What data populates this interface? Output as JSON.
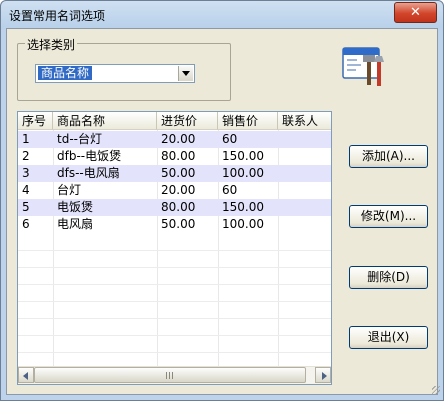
{
  "window": {
    "title": "设置常用名词选项",
    "close_symbol": "✕"
  },
  "category": {
    "legend": "选择类别",
    "selected": "商品名称"
  },
  "table": {
    "columns": [
      "序号",
      "商品名称",
      "进货价",
      "销售价",
      "联系人"
    ],
    "rows": [
      [
        "1",
        "td--台灯",
        "20.00",
        "60",
        ""
      ],
      [
        "2",
        "dfb--电饭煲",
        "80.00",
        "150.00",
        ""
      ],
      [
        "3",
        "dfs--电风扇",
        "50.00",
        "100.00",
        ""
      ],
      [
        "4",
        "台灯",
        "20.00",
        "60",
        ""
      ],
      [
        "5",
        "电饭煲",
        "80.00",
        "150.00",
        ""
      ],
      [
        "6",
        "电风扇",
        "50.00",
        "100.00",
        ""
      ]
    ]
  },
  "buttons": {
    "add": "添加(A)...",
    "modify": "修改(M)...",
    "delete": "删除(D)",
    "exit": "退出(X)"
  },
  "icons": {
    "app": "tools-window-icon",
    "combo_arrow": "chevron-down-icon"
  }
}
